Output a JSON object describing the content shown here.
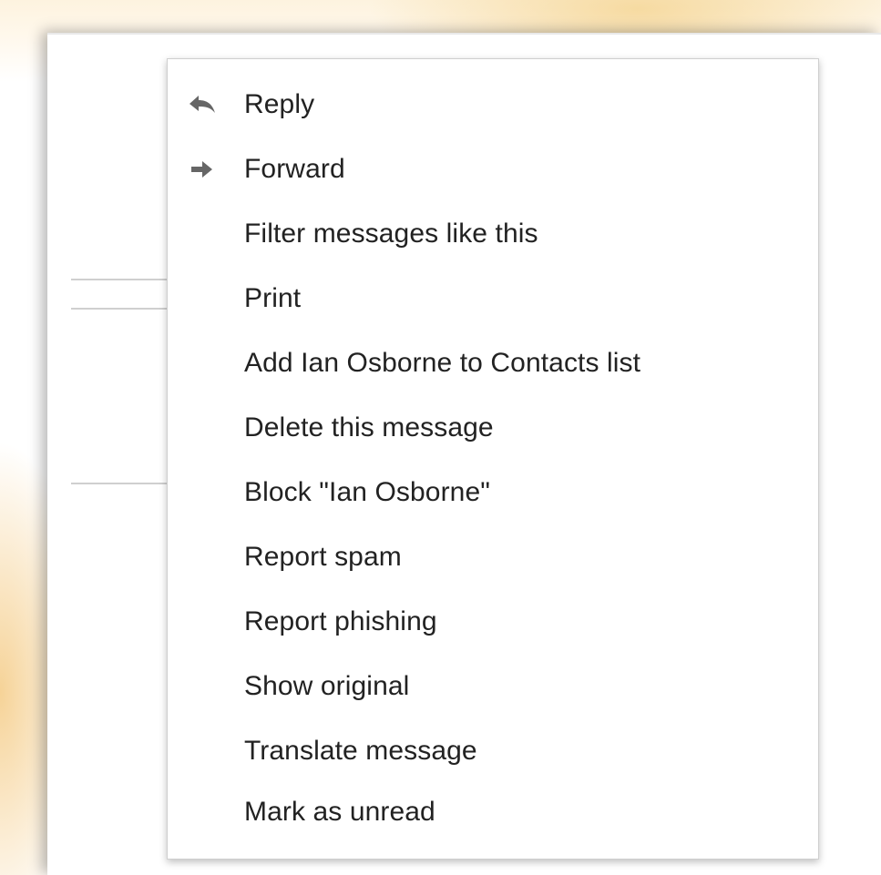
{
  "menu": {
    "items": [
      {
        "label": "Reply",
        "icon": "reply-icon"
      },
      {
        "label": "Forward",
        "icon": "forward-icon"
      },
      {
        "label": "Filter messages like this"
      },
      {
        "label": "Print"
      },
      {
        "label": "Add Ian Osborne to Contacts list"
      },
      {
        "label": "Delete this message"
      },
      {
        "label": "Block \"Ian Osborne\""
      },
      {
        "label": "Report spam"
      },
      {
        "label": "Report phishing"
      },
      {
        "label": "Show original"
      },
      {
        "label": "Translate message"
      },
      {
        "label": "Mark as unread"
      }
    ]
  },
  "colors": {
    "menu_text": "#222222",
    "icon": "#666666",
    "menu_border": "#cfcfcf",
    "glow": "#f5d696"
  }
}
